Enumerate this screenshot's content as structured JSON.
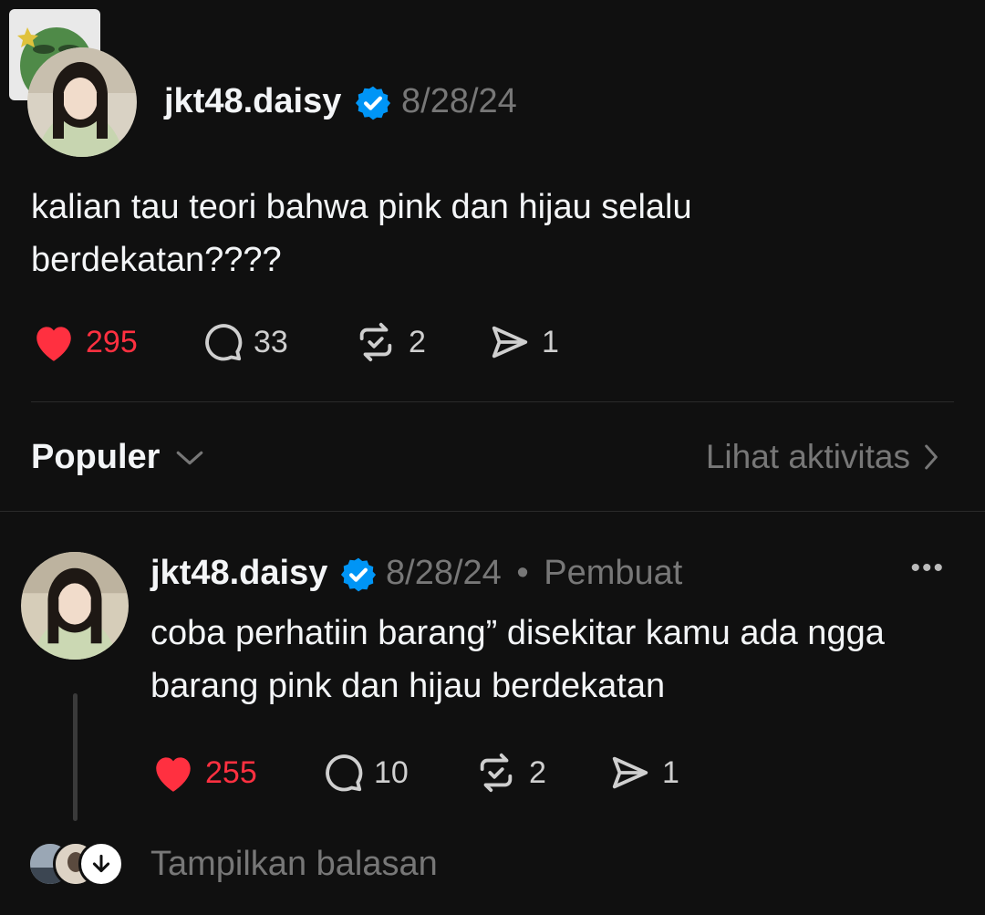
{
  "post": {
    "username": "jkt48.daisy",
    "date": "8/28/24",
    "text_line1": "kalian tau teori bahwa pink dan hijau selalu",
    "text_line2": "berdekatan????",
    "likes": "295",
    "comments": "33",
    "reposts": "2",
    "shares": "1"
  },
  "filter": {
    "sort_label": "Populer",
    "activity_label": "Lihat aktivitas"
  },
  "reply": {
    "username": "jkt48.daisy",
    "date": "8/28/24",
    "separator": "•",
    "author_tag": "Pembuat",
    "more": "•••",
    "text_line1": "coba perhatiin barang” disekitar kamu ada ngga",
    "text_line2": "barang pink dan hijau berdekatan",
    "likes": "255",
    "comments": "10",
    "reposts": "2",
    "shares": "1"
  },
  "show_replies_label": "Tampilkan balasan",
  "colors": {
    "background": "#101010",
    "liked": "#ff3040",
    "verified": "#0095f6",
    "muted": "#777777"
  }
}
